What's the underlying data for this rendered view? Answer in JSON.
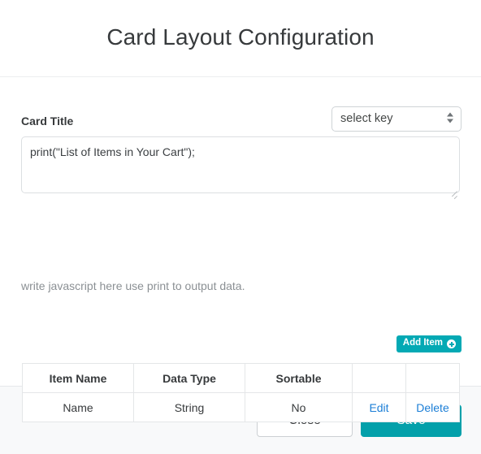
{
  "header": {
    "title": "Card Layout Configuration"
  },
  "form": {
    "card_title_label": "Card Title",
    "key_select": {
      "selected": "select key",
      "options": [
        "select key"
      ]
    },
    "script_value": "print(\"List of Items in Your Cart\");",
    "script_placeholder": "",
    "help_text": "write javascript here use print to output data."
  },
  "toolbar": {
    "add_item_label": "Add Item",
    "add_item_icon": "circle-plus-icon"
  },
  "table": {
    "columns": [
      "Item Name",
      "Data Type",
      "Sortable",
      "",
      ""
    ],
    "rows": [
      {
        "item_name": "Name",
        "data_type": "String",
        "sortable": "No",
        "edit_label": "Edit",
        "delete_label": "Delete"
      }
    ]
  },
  "footer": {
    "close_label": "Close",
    "save_label": "Save"
  },
  "colors": {
    "accent_teal": "#03a0aa",
    "add_button_teal": "#03a9b4",
    "link_blue": "#1b7ed6",
    "text_dark": "#373a3c",
    "muted_text": "#8b9094",
    "footer_bg": "#f8f9fa",
    "border": "#e4e6e8"
  }
}
